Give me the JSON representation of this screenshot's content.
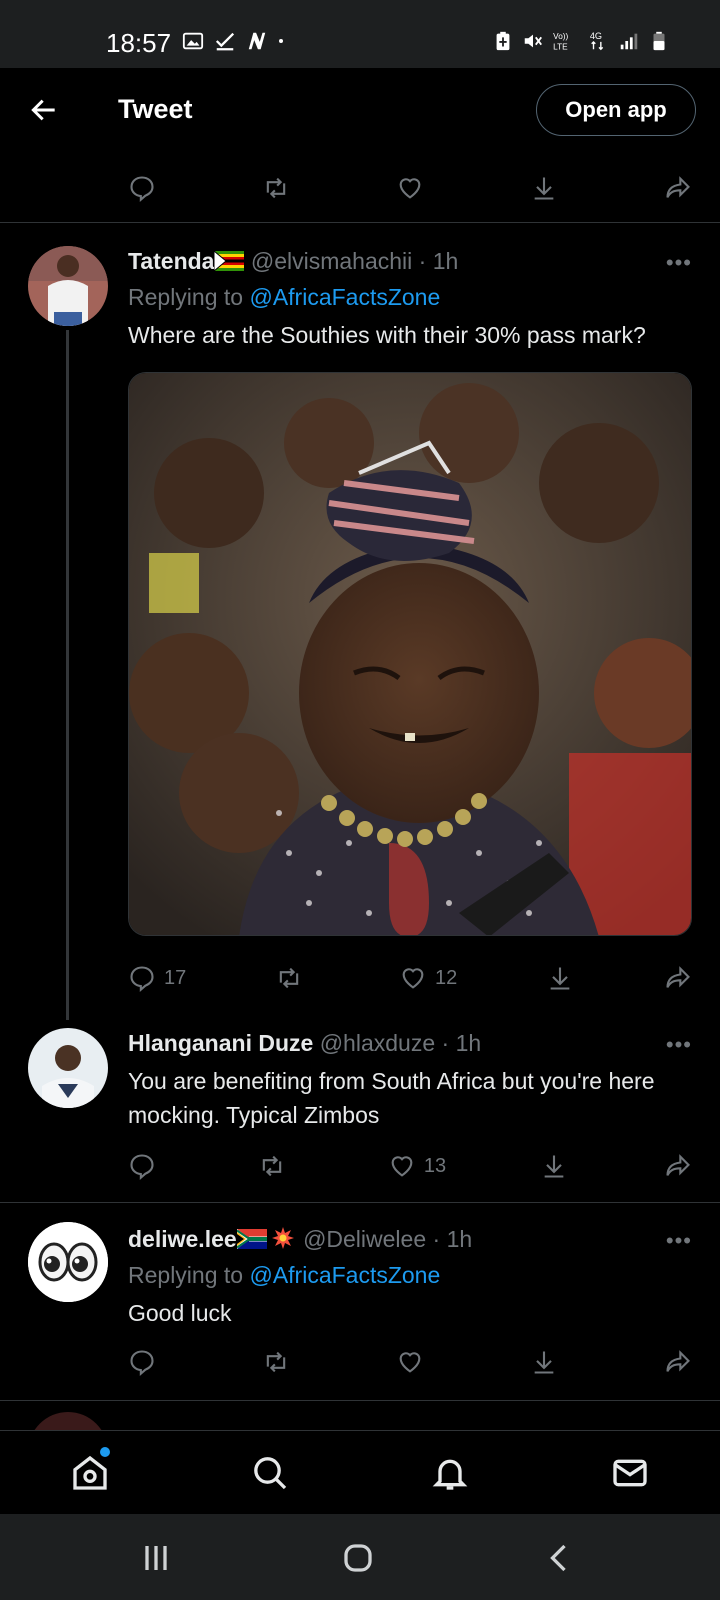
{
  "status_bar": {
    "time": "18:57",
    "left_icons": [
      "gallery-icon",
      "check-icon",
      "n-app-icon",
      "dot-icon"
    ],
    "right_icons": [
      "battery-saver-icon",
      "mute-icon",
      "volte-icon",
      "4g-icon",
      "signal-icon",
      "battery-icon"
    ]
  },
  "header": {
    "title": "Tweet",
    "open_app_label": "Open app"
  },
  "tweets": [
    {
      "name": "Tatenda",
      "flag": "zimbabwe-flag-icon",
      "handle": "@elvismahachii",
      "time": "· 1h",
      "replying_prefix": "Replying to",
      "replying_to": "@AfricaFactsZone",
      "text": "Where are the Southies with their 30% pass mark?",
      "replies": "17",
      "retweets": "",
      "likes": "12"
    },
    {
      "name": "Hlanganani Duze",
      "handle": "@hlaxduze",
      "time": "· 1h",
      "text": "You are benefiting from South Africa but you're here mocking. Typical Zimbos",
      "replies": "",
      "retweets": "",
      "likes": "13"
    },
    {
      "name": "deliwe.lee",
      "flag": "south-africa-flag-icon",
      "emoji": "collision-icon",
      "handle": "@Deliwelee",
      "time": "· 1h",
      "replying_prefix": "Replying to",
      "replying_to": "@AfricaFactsZone",
      "text": "Good luck",
      "replies": "",
      "retweets": "",
      "likes": ""
    }
  ],
  "colors": {
    "background": "#000000",
    "text": "#e7e9ea",
    "muted": "#71767b",
    "accent": "#1d9bf0",
    "divider": "#2f3336"
  },
  "bottom_nav": [
    "home-icon",
    "search-icon",
    "notifications-icon",
    "messages-icon"
  ],
  "system_nav": [
    "recents-icon",
    "home-circle-icon",
    "back-chevron-icon"
  ]
}
